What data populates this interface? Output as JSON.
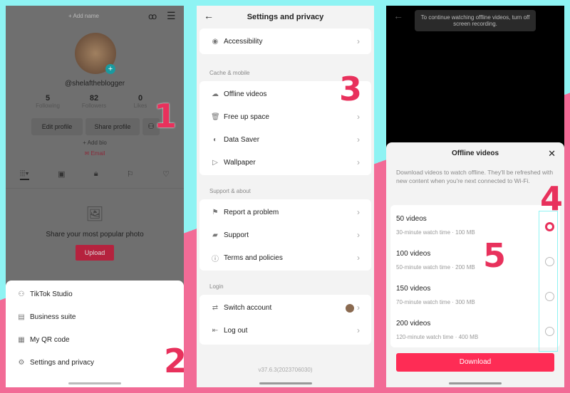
{
  "profile": {
    "add_name": "+ Add name",
    "username": "@shelaftheblogger",
    "stats": [
      {
        "value": "5",
        "label": "Following"
      },
      {
        "value": "82",
        "label": "Followers"
      },
      {
        "value": "0",
        "label": "Likes"
      }
    ],
    "edit_profile": "Edit profile",
    "share_profile": "Share profile",
    "add_bio": "+ Add bio",
    "email": "Email",
    "empty_text": "Share your most popular photo",
    "upload": "Upload",
    "menu": [
      {
        "label": "TikTok Studio",
        "icon": "person-star-icon"
      },
      {
        "label": "Business suite",
        "icon": "store-icon"
      },
      {
        "label": "My QR code",
        "icon": "qr-code-icon"
      },
      {
        "label": "Settings and privacy",
        "icon": "gear-icon"
      }
    ]
  },
  "settings": {
    "title": "Settings and privacy",
    "accessibility": "Accessibility",
    "cache_section": "Cache & mobile",
    "cache_items": [
      "Offline videos",
      "Free up space",
      "Data Saver",
      "Wallpaper"
    ],
    "support_section": "Support & about",
    "support_items": [
      "Report a problem",
      "Support",
      "Terms and policies"
    ],
    "login_section": "Login",
    "login_items": [
      "Switch account",
      "Log out"
    ],
    "version": "v37.6.3(2023706030)"
  },
  "offline": {
    "toast": "To continue watching offline videos, turn off screen recording.",
    "title": "Offline videos",
    "description": "Download videos to watch offline. They'll be refreshed with new content when you're next connected to Wi-Fi.",
    "options": [
      {
        "title": "50 videos",
        "sub": "30-minute watch time · 100 MB"
      },
      {
        "title": "100 videos",
        "sub": "50-minute watch time · 200 MB"
      },
      {
        "title": "150 videos",
        "sub": "70-minute watch time · 300 MB"
      },
      {
        "title": "200 videos",
        "sub": "120-minute watch time · 400 MB"
      }
    ],
    "download": "Download"
  },
  "steps": [
    "1",
    "2",
    "3",
    "4",
    "5"
  ],
  "colors": {
    "accent": "#fe2c55",
    "step": "#e8315c",
    "cyan": "#8ef3f3",
    "pink": "#f26b96"
  }
}
